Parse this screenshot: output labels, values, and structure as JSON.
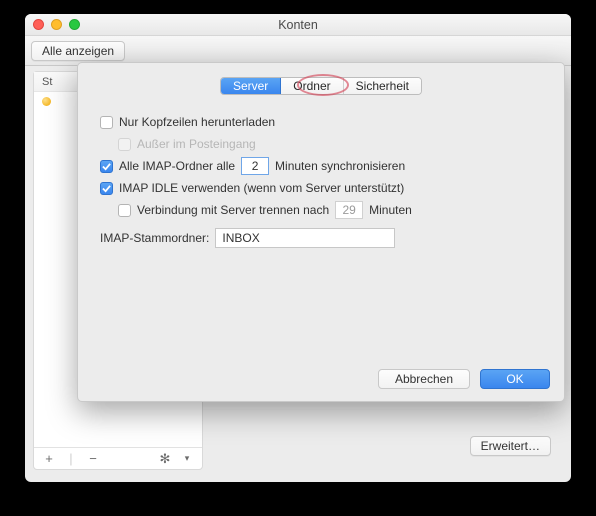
{
  "window": {
    "title": "Konten",
    "show_all_label": "Alle anzeigen"
  },
  "sidebar": {
    "header_prefix": "St",
    "footer": {
      "add": "+",
      "divider": "|",
      "remove": "−",
      "gear": "✻",
      "gear_menu": "▾"
    }
  },
  "advanced_button": "Erweitert…",
  "sheet": {
    "tabs": {
      "server": "Server",
      "folders": "Ordner",
      "security": "Sicherheit"
    },
    "headers_only_label": "Nur Kopfzeilen herunterladen",
    "except_inbox_label": "Außer im Posteingang",
    "sync_prefix": "Alle IMAP-Ordner alle",
    "sync_value": "2",
    "sync_suffix": "Minuten synchronisieren",
    "idle_label": "IMAP IDLE verwenden (wenn vom Server unterstützt)",
    "disconnect_label": "Verbindung mit Server trennen nach",
    "disconnect_value": "29",
    "disconnect_unit": "Minuten",
    "root_label": "IMAP-Stammordner:",
    "root_value": "INBOX",
    "cancel": "Abbrechen",
    "ok": "OK"
  }
}
